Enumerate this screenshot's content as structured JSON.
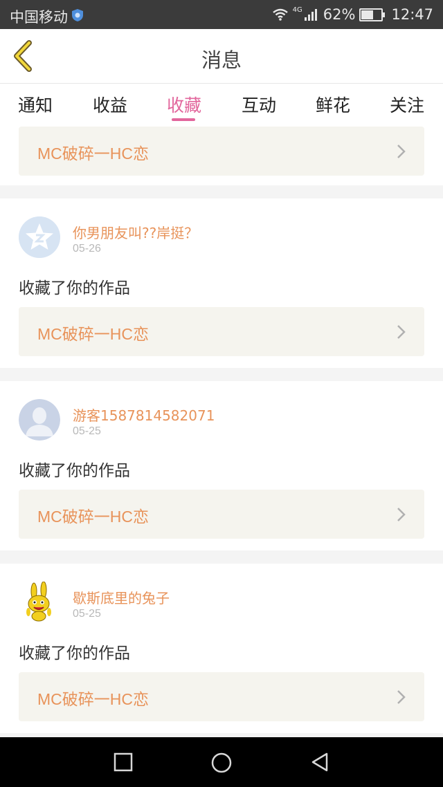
{
  "status_bar": {
    "carrier": "中国移动",
    "network": "4G",
    "battery": "62%",
    "battery_level": 0.62,
    "time": "12:47"
  },
  "header": {
    "title": "消息"
  },
  "tabs": [
    {
      "label": "通知",
      "active": false
    },
    {
      "label": "收益",
      "active": false
    },
    {
      "label": "收藏",
      "active": true
    },
    {
      "label": "互动",
      "active": false
    },
    {
      "label": "鲜花",
      "active": false
    },
    {
      "label": "关注",
      "active": false
    }
  ],
  "colors": {
    "accent": "#e2669c",
    "name": "#e8935a",
    "card_bg": "#f5f4ee"
  },
  "messages": [
    {
      "work_title": "MC破碎一HC恋"
    },
    {
      "user": "你男朋友叫??岸挺？",
      "date": "05-26",
      "action": "收藏了你的作品",
      "work_title": "MC破碎一HC恋",
      "avatar": "qzone-star-avatar"
    },
    {
      "user": "游客1587814582071",
      "date": "05-25",
      "action": "收藏了你的作品",
      "work_title": "MC破碎一HC恋",
      "avatar": "default-person-avatar"
    },
    {
      "user": "歇斯底里的兔子",
      "date": "05-25",
      "action": "收藏了你的作品",
      "work_title": "MC破碎一HC恋",
      "avatar": "yellow-bunny-avatar"
    }
  ]
}
